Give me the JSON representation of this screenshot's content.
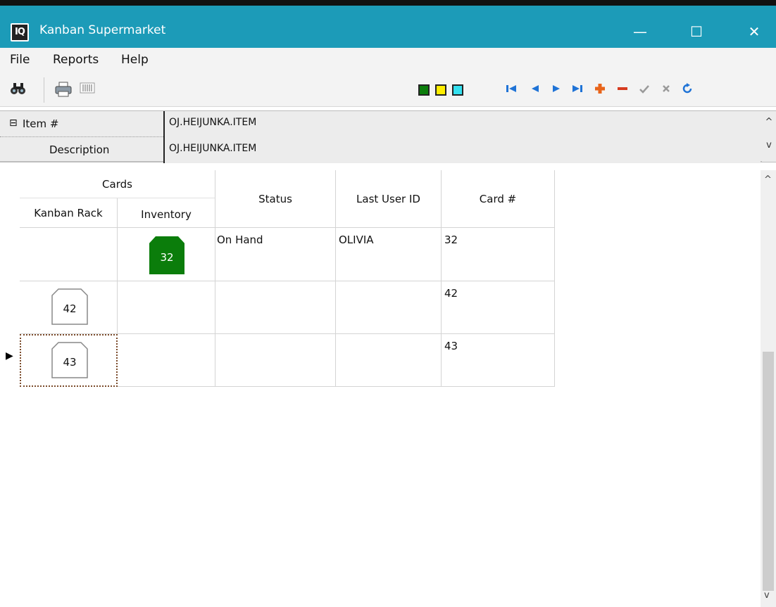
{
  "window": {
    "app_icon_text": "IQ",
    "title": "Kanban Supermarket",
    "minimize": "—",
    "maximize": "☐",
    "close": "✕"
  },
  "menu": [
    "File",
    "Reports",
    "Help"
  ],
  "toolbar": {
    "colors": {
      "green": "#0b7d0b",
      "yellow": "#ffee00",
      "cyan": "#34e0ef",
      "nav_blue": "#1f73d6",
      "plus_orange": "#e8641a",
      "minus_red": "#d63b1f"
    },
    "icons": [
      "find-icon",
      "print-icon",
      "barcode-icon",
      "first-record-icon",
      "prev-record-icon",
      "next-record-icon",
      "last-record-icon",
      "add-record-icon",
      "delete-record-icon",
      "post-icon",
      "cancel-icon",
      "refresh-icon"
    ]
  },
  "header": {
    "collapse_icon": "⊟",
    "item_label": "Item #",
    "item_value": "OJ.HEIJUNKA.ITEM",
    "desc_label": "Description",
    "desc_value": "OJ.HEIJUNKA.ITEM",
    "scroll_up": "^",
    "scroll_down": "v"
  },
  "grid": {
    "group_header": "Cards",
    "columns": [
      "Kanban Rack",
      "Inventory",
      "Status",
      "Last User ID",
      "Card #"
    ],
    "rows": [
      {
        "kanban_rack": "",
        "inventory": "32",
        "status": "On Hand",
        "last_user_id": "OLIVIA",
        "card_no": "32"
      },
      {
        "kanban_rack": "42",
        "inventory": "",
        "status": "",
        "last_user_id": "",
        "card_no": "42"
      },
      {
        "kanban_rack": "43",
        "inventory": "",
        "status": "",
        "last_user_id": "",
        "card_no": "43"
      }
    ],
    "row_indicator": "▶",
    "scroll_up": "^",
    "scroll_down": "v"
  }
}
